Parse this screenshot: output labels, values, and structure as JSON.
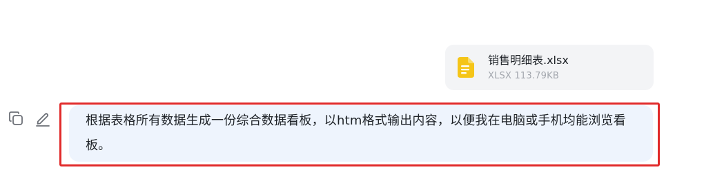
{
  "attachment": {
    "icon": "spreadsheet-file-icon",
    "icon_color": "#f5c518",
    "file_name": "销售明细表.xlsx",
    "file_meta": "XLSX 113.79KB"
  },
  "actions": {
    "copy_icon": "copy-icon",
    "edit_icon": "edit-pencil-icon"
  },
  "message": {
    "text": "根据表格所有数据生成一份综合数据看板，以htm格式输出内容，以便我在电脑或手机均能浏览看板。",
    "bubble_color": "#eef4fd",
    "highlight_color": "#e12a2a"
  }
}
